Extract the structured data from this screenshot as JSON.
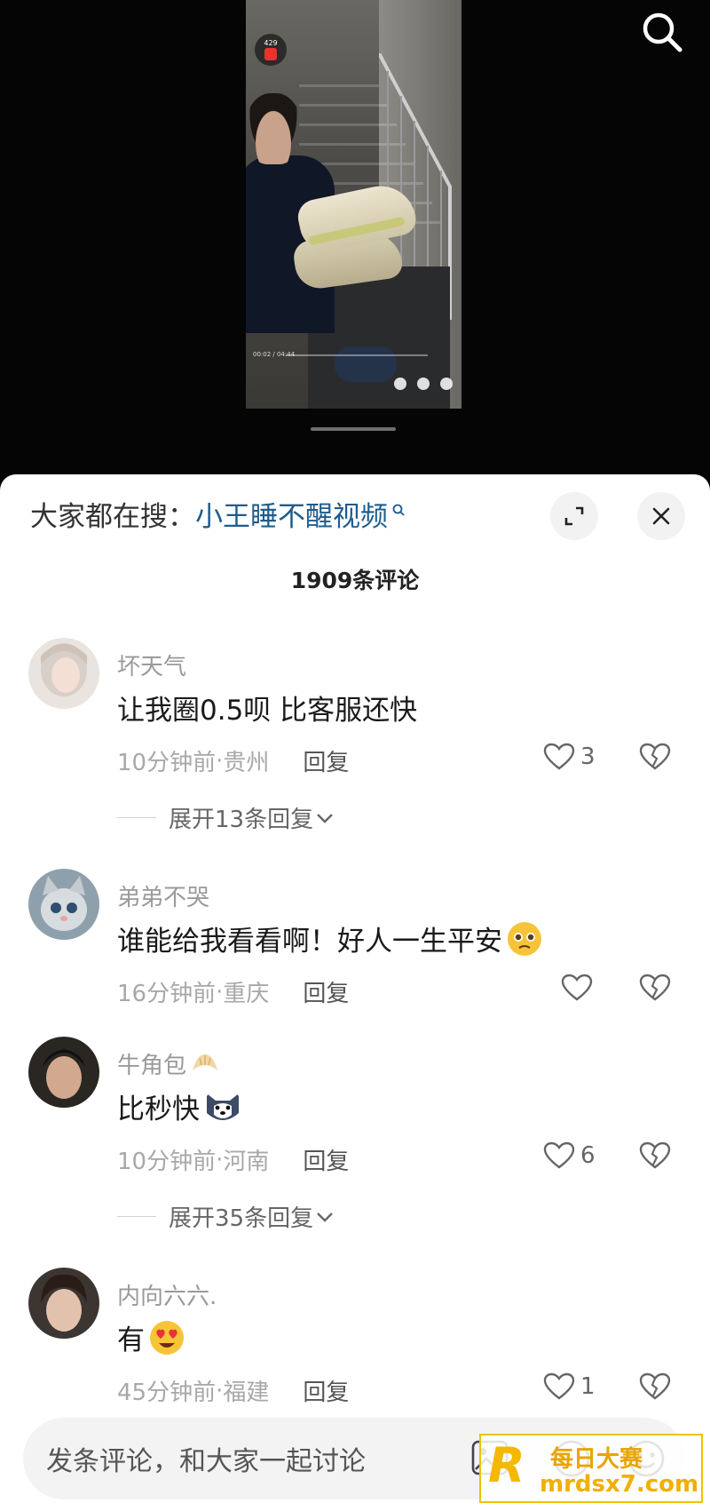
{
  "video": {
    "redpacket_count": "429",
    "progress_text": "00:02 / 04:44"
  },
  "sheet": {
    "hot_search_label": "大家都在搜：",
    "hot_search_term": "小王睡不醒视频",
    "comment_count": "1909条评论"
  },
  "comments": [
    {
      "user": "坏天气",
      "text": "让我圈0.5呗 比客服还快",
      "time": "10分钟前",
      "location": "贵州",
      "reply_label": "回复",
      "likes": "3",
      "expand_label": "展开13条回复"
    },
    {
      "user": "弟弟不哭",
      "text": "谁能给我看看啊！好人一生平安",
      "emoji": "pleading-face",
      "time": "16分钟前",
      "location": "重庆",
      "reply_label": "回复",
      "likes": ""
    },
    {
      "user": "牛角包",
      "user_emoji": "croissant",
      "text": "比秒快",
      "emoji": "husky-dog",
      "time": "10分钟前",
      "location": "河南",
      "reply_label": "回复",
      "likes": "6",
      "expand_label": "展开35条回复"
    },
    {
      "user": "内向六六.",
      "text": "有",
      "emoji": "heart-eyes-face",
      "time": "45分钟前",
      "location": "福建",
      "reply_label": "回复",
      "likes": "1"
    }
  ],
  "meta_separator": " · ",
  "input": {
    "placeholder": "发条评论，和大家一起讨论"
  },
  "watermark": {
    "logo": "R",
    "line1": "每日大赛",
    "line2": "mrdsx7.com"
  },
  "colors": {
    "accent_link": "#1f5c8c",
    "sheet_bg": "#ffffff",
    "video_bg": "#050505"
  }
}
